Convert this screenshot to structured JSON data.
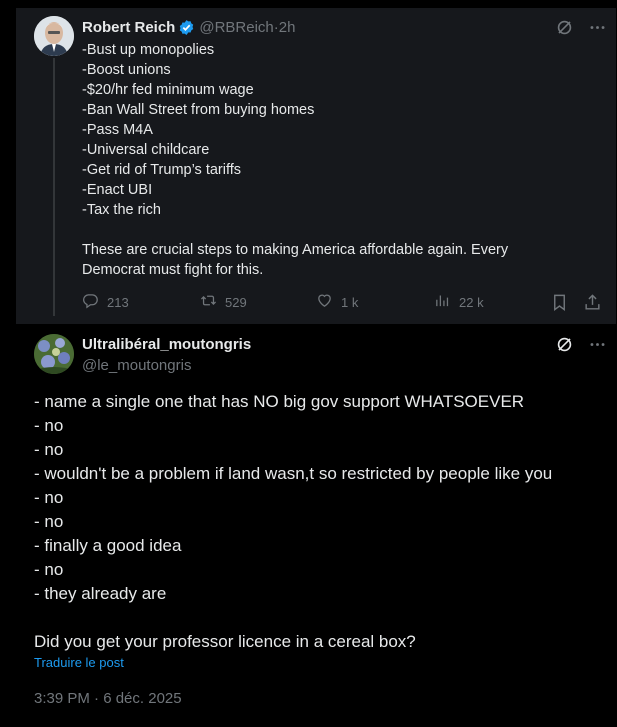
{
  "parent_tweet": {
    "display_name": "Robert Reich",
    "handle": "@RBReich",
    "time": "2h",
    "separator": " · ",
    "text": "-Bust up monopolies\n-Boost unions\n-$20/hr fed minimum wage\n-Ban Wall Street from buying homes\n-Pass M4A\n-Universal childcare\n-Get rid of Trump’s tariffs\n-Enact UBI\n-Tax the rich\n\nThese are crucial steps to making America affordable again. Every\nDemocrat must fight for this.",
    "stats": {
      "replies": "213",
      "reposts": "529",
      "likes": "1 k",
      "views": "22 k"
    }
  },
  "reply_tweet": {
    "display_name": "Ultralibéral_moutongris",
    "handle": "@le_moutongris",
    "text": "- name a single one that has NO big gov support WHATSOEVER\n- no\n- no\n- wouldn't be a problem if land wasn,t so restricted by people like you\n- no\n- no\n- finally a good idea\n- no\n- they already are\n\nDid you get your professor licence in a cereal box?",
    "translate_label": "Traduire le post",
    "timestamp": "3:39 PM · 6 déc. 2025"
  },
  "colors": {
    "background": "#000000",
    "parent_background": "#16181c",
    "text": "#e7e9ea",
    "muted": "#71767b",
    "link": "#1d9bf0",
    "verified": "#1d9bf0"
  },
  "icons": {
    "grok": "grok-icon",
    "more": "more-icon",
    "reply": "reply-icon",
    "repost": "repost-icon",
    "like": "heart-icon",
    "views": "views-icon",
    "bookmark": "bookmark-icon",
    "share": "share-icon",
    "verified": "verified-badge-icon"
  }
}
